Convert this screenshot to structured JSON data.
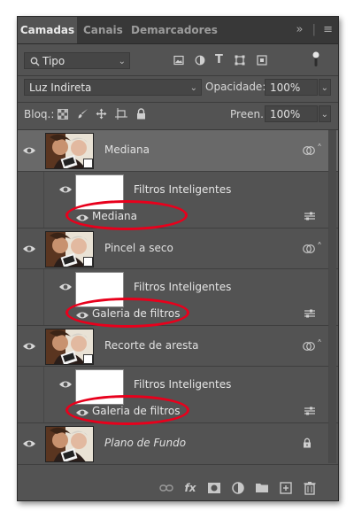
{
  "tabs": [
    {
      "label": "Camadas",
      "active": true
    },
    {
      "label": "Canais",
      "active": false
    },
    {
      "label": "Demarcadores",
      "active": false
    }
  ],
  "tab_controls": {
    "expand": "»",
    "menu": "≡"
  },
  "filter": {
    "kind": "Tipo"
  },
  "blend": {
    "mode": "Luz Indireta",
    "opacity_label": "Opacidade:",
    "opacity": "100%"
  },
  "lock": {
    "label": "Bloq.:",
    "fill_label": "Preen.:",
    "fill": "100%"
  },
  "layers": [
    {
      "name": "Mediana",
      "selected": true,
      "smart_filters_label": "Filtros Inteligentes",
      "filter": "Mediana"
    },
    {
      "name": "Pincel a seco",
      "selected": false,
      "smart_filters_label": "Filtros Inteligentes",
      "filter": "Galeria de filtros"
    },
    {
      "name": "Recorte de aresta",
      "selected": false,
      "smart_filters_label": "Filtros Inteligentes",
      "filter": "Galeria de filtros"
    },
    {
      "name": "Plano de Fundo",
      "selected": false,
      "locked": true
    }
  ],
  "highlight_color": "#e8001c",
  "footer_icons": [
    "link-icon",
    "fx-icon",
    "mask-icon",
    "adjustment-icon",
    "folder-icon",
    "new-layer-icon",
    "trash-icon"
  ]
}
